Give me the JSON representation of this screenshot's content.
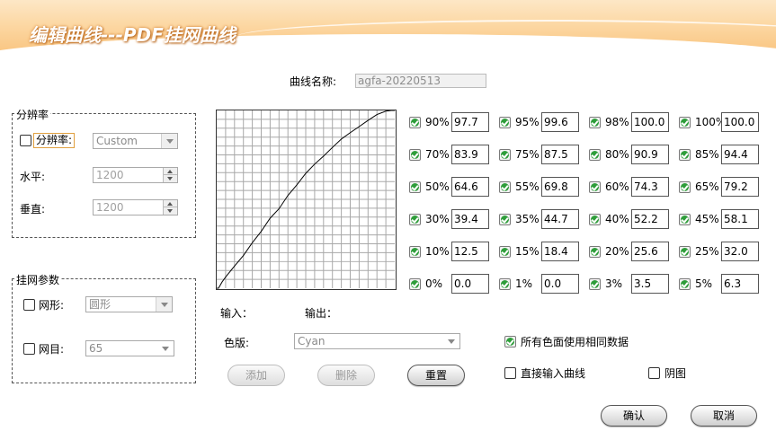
{
  "window": {
    "title": "编辑曲线---PDF挂网曲线"
  },
  "curve_name": {
    "label": "曲线名称:",
    "value": "agfa-20220513"
  },
  "resolution": {
    "group_title": "分辨率",
    "checkbox_label": "分辨率:",
    "checked": false,
    "combo_value": "Custom",
    "horizontal_label": "水平:",
    "horizontal_value": "1200",
    "vertical_label": "垂直:",
    "vertical_value": "1200"
  },
  "screen": {
    "group_title": "挂网参数",
    "shape_label": "网形:",
    "shape_checked": false,
    "shape_value": "圆形",
    "lpi_label": "网目:",
    "lpi_checked": false,
    "lpi_value": "65"
  },
  "graph": {
    "input_label": "输入：",
    "output_label": "输出：",
    "grid_divisions": 20
  },
  "points": [
    {
      "label": "90%",
      "value": "97.7",
      "checked": true
    },
    {
      "label": "95%",
      "value": "99.6",
      "checked": true
    },
    {
      "label": "98%",
      "value": "100.0",
      "checked": true
    },
    {
      "label": "100%",
      "value": "100.0",
      "checked": true
    },
    {
      "label": "70%",
      "value": "83.9",
      "checked": true
    },
    {
      "label": "75%",
      "value": "87.5",
      "checked": true
    },
    {
      "label": "80%",
      "value": "90.9",
      "checked": true
    },
    {
      "label": "85%",
      "value": "94.4",
      "checked": true
    },
    {
      "label": "50%",
      "value": "64.6",
      "checked": true
    },
    {
      "label": "55%",
      "value": "69.8",
      "checked": true
    },
    {
      "label": "60%",
      "value": "74.3",
      "checked": true
    },
    {
      "label": "65%",
      "value": "79.2",
      "checked": true
    },
    {
      "label": "30%",
      "value": "39.4",
      "checked": true
    },
    {
      "label": "35%",
      "value": "44.7",
      "checked": true
    },
    {
      "label": "40%",
      "value": "52.2",
      "checked": true
    },
    {
      "label": "45%",
      "value": "58.1",
      "checked": true
    },
    {
      "label": "10%",
      "value": "12.5",
      "checked": true
    },
    {
      "label": "15%",
      "value": "18.4",
      "checked": true
    },
    {
      "label": "20%",
      "value": "25.6",
      "checked": true
    },
    {
      "label": "25%",
      "value": "32.0",
      "checked": true
    },
    {
      "label": "0%",
      "value": "0.0",
      "checked": true
    },
    {
      "label": "1%",
      "value": "0.0",
      "checked": true
    },
    {
      "label": "3%",
      "value": "3.5",
      "checked": true
    },
    {
      "label": "5%",
      "value": "6.3",
      "checked": true
    }
  ],
  "plate": {
    "label": "色版:",
    "value": "Cyan"
  },
  "options": {
    "same_data_label": "所有色面使用相同数据",
    "same_data_checked": true,
    "direct_input_label": "直接输入曲线",
    "direct_input_checked": false,
    "negative_label": "阴图",
    "negative_checked": false
  },
  "buttons": {
    "add": "添加",
    "delete": "删除",
    "reset": "重置",
    "ok": "确认",
    "cancel": "取消"
  },
  "colors": {
    "header_orange": "#f9c27b",
    "check_green": "#2e9d3a"
  }
}
